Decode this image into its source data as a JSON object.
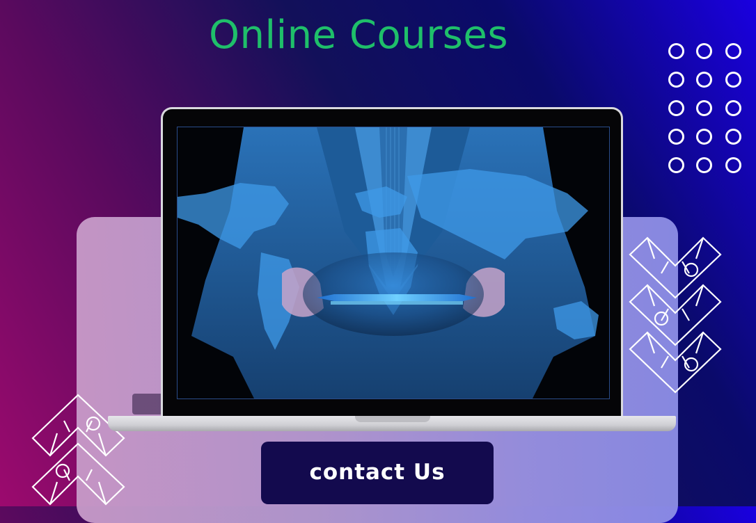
{
  "header": {
    "title": "Online Courses"
  },
  "cta": {
    "label": "contact Us"
  },
  "colors": {
    "title": "#1fbf6a",
    "button_bg": "#130a4e",
    "background_left": "#9c0a6e",
    "background_right": "#1a00e0"
  },
  "illustration": {
    "laptop_image": "businessman-holding-tablet-with-world-map-icon"
  }
}
